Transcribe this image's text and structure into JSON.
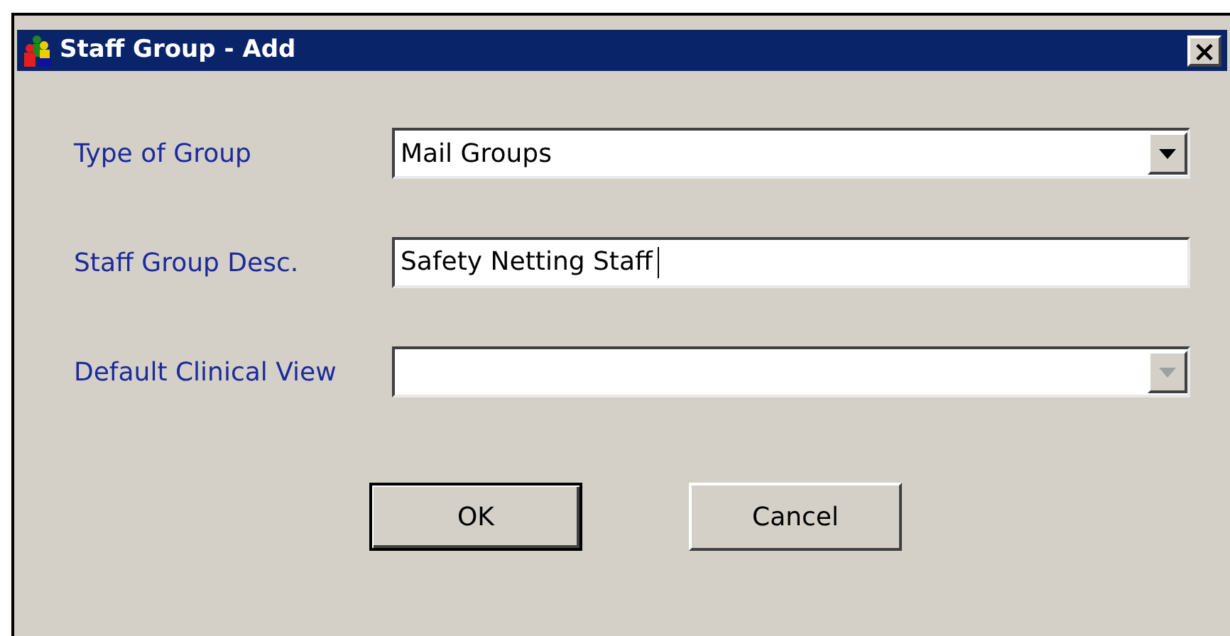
{
  "window": {
    "title": "Staff Group - Add",
    "close": "×"
  },
  "fields": [
    {
      "label": "Type of Group",
      "kind": "combo",
      "value": "Mail Groups",
      "disabled": false
    },
    {
      "label": "Staff Group Desc.",
      "kind": "text",
      "value": "Safety Netting Staff"
    },
    {
      "label": "Default Clinical View",
      "kind": "combo",
      "disabled": true
    }
  ],
  "buttons": [
    {
      "label": "OK",
      "default": true
    },
    {
      "label": "Cancel",
      "default": false
    }
  ]
}
